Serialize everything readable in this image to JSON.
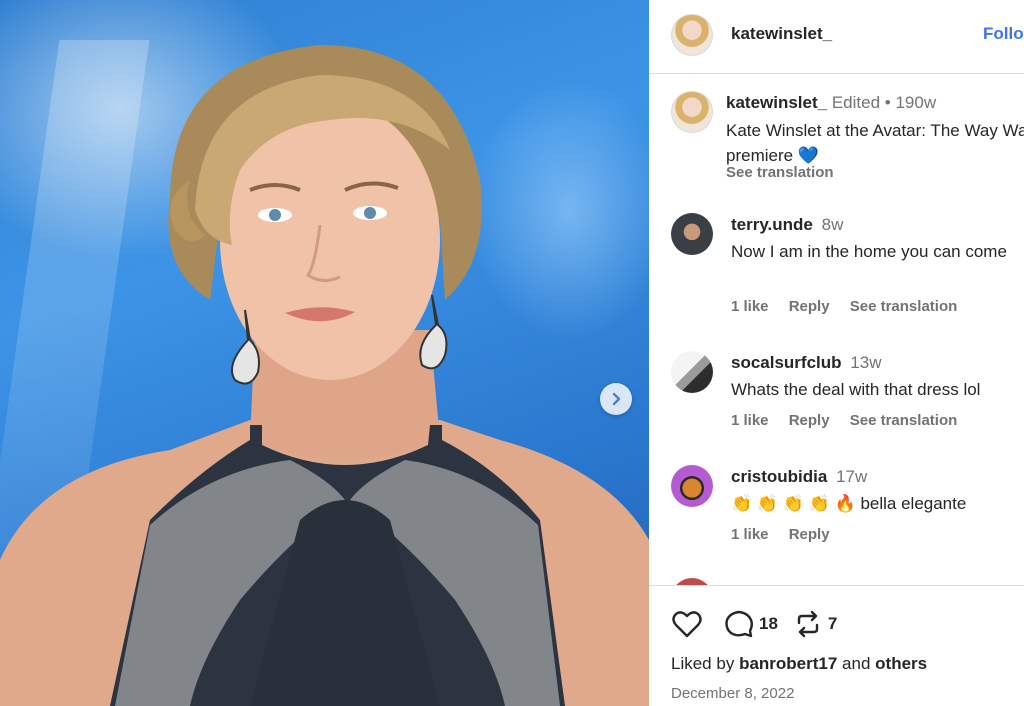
{
  "photo": {
    "description_icon": "next-arrow-icon",
    "colors": {
      "backdrop": "#3d94e6",
      "dress": "#2b3440",
      "beading": "#9a9a9a"
    }
  },
  "header": {
    "username": "katewinslet_",
    "follow_label": "Follo"
  },
  "caption": {
    "username": "katewinslet_",
    "edited": "Edited",
    "dot": "•",
    "age": "190w",
    "text": "Kate Winslet at the Avatar: The Way Water premiere 💙",
    "see_translation": "See translation"
  },
  "comments": [
    {
      "username": "terry.unde",
      "time": "8w",
      "text": "Now I am in the home you can come",
      "likes": "1 like",
      "reply": "Reply",
      "translate": "See translation"
    },
    {
      "username": "socalsurfclub",
      "time": "13w",
      "text": "Whats the deal with that dress lol",
      "likes": "1 like",
      "reply": "Reply",
      "translate": "See translation"
    },
    {
      "username": "cristoubidia",
      "time": "17w",
      "text": "👏 👏 👏 👏 🔥 bella elegante",
      "likes": "1 like",
      "reply": "Reply"
    }
  ],
  "footer": {
    "comment_count": "18",
    "repost_count": "7",
    "liked_prefix": "Liked by",
    "liked_user": "banrobert17",
    "liked_and": "and",
    "liked_others": "others",
    "date": "December 8, 2022"
  },
  "colors": {
    "link": "#3f74ef",
    "muted": "#737373",
    "border": "#dbdbdb"
  }
}
